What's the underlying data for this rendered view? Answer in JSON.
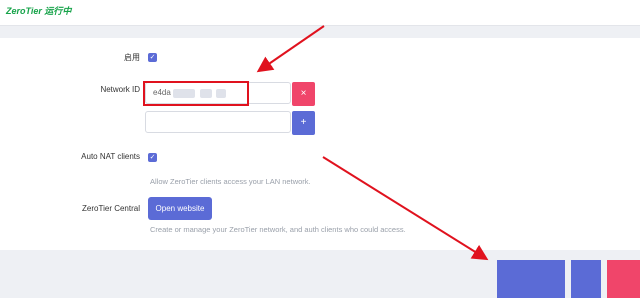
{
  "header": {
    "status": "ZeroTier 运行中"
  },
  "form": {
    "enabled_label": "启用",
    "network_id_label": "Network ID",
    "network_id_value": "e4da",
    "remove_symbol": "×",
    "add_symbol": "+",
    "auto_nat_label": "Auto NAT clients",
    "auto_nat_hint": "Allow ZeroTier clients access your LAN network.",
    "central_label": "ZeroTier Central",
    "open_website_label": "Open website",
    "central_hint": "Create or manage your ZeroTier network, and auth clients who could access.",
    "check_symbol": "✓"
  },
  "colors": {
    "accent": "#5b6bd6",
    "danger": "#f0456a",
    "status_green": "#17a34a",
    "annotation_red": "#e0121e"
  }
}
